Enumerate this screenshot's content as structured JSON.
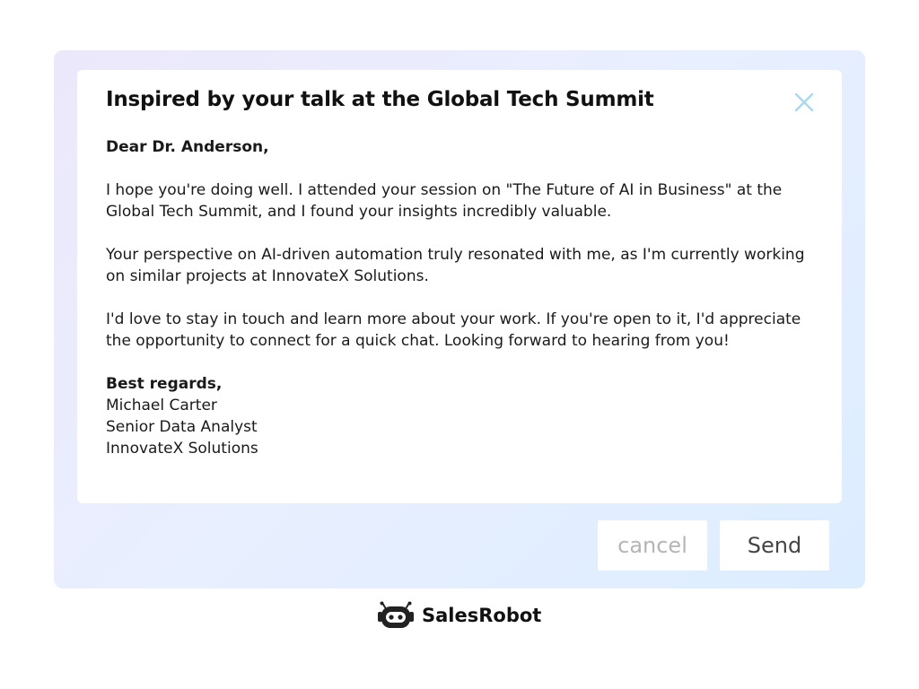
{
  "email": {
    "subject": "Inspired by your talk at the Global Tech Summit",
    "greeting": "Dear Dr. Anderson,",
    "paragraphs": [
      "I hope you're doing well. I attended your session on \"The Future of AI in Business\" at the Global Tech Summit, and I found your insights incredibly valuable.",
      "Your perspective on AI-driven automation truly resonated with me, as I'm currently working on similar projects at InnovateX Solutions.",
      "I'd love to stay in touch and learn more about your work. If you're open to it, I'd appreciate the opportunity to connect for a quick chat. Looking forward to hearing from you!"
    ],
    "signoff": "Best regards,",
    "signature": {
      "name": "Michael Carter",
      "title": "Senior Data Analyst",
      "company": "InnovateX Solutions"
    }
  },
  "actions": {
    "cancel_label": "cancel",
    "send_label": "Send"
  },
  "brand": {
    "name": "SalesRobot",
    "logo_icon": "robot-icon"
  },
  "colors": {
    "close_icon": "#a9d9f0",
    "cancel_text": "#b5b5b5",
    "send_text": "#444444"
  }
}
